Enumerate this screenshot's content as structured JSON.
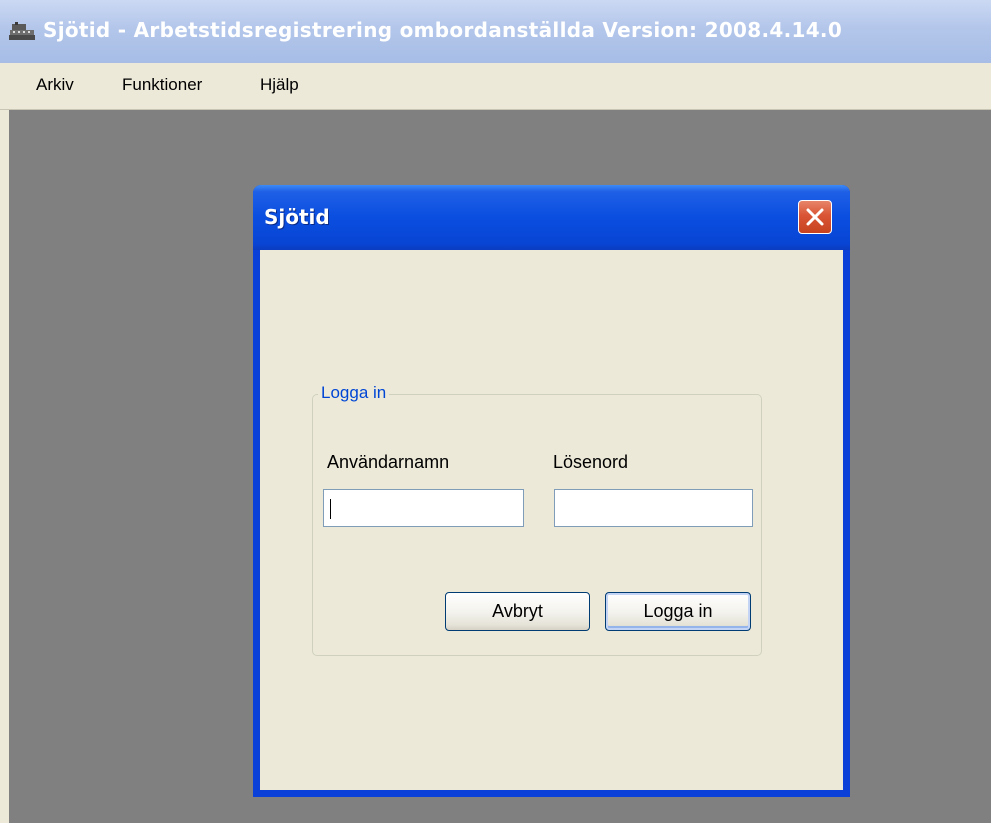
{
  "app": {
    "title": "Sjötid - Arbetstidsregistrering ombordanställda Version: 2008.4.14.0",
    "icon": "ship-icon"
  },
  "menu": {
    "items": [
      {
        "label": "Arkiv"
      },
      {
        "label": "Funktioner"
      },
      {
        "label": "Hjälp"
      }
    ]
  },
  "dialog": {
    "title": "Sjötid",
    "close_icon": "close-icon",
    "group": {
      "legend": "Logga in",
      "username_label": "Användarnamn",
      "username_value": "",
      "password_label": "Lösenord",
      "password_value": ""
    },
    "buttons": {
      "cancel_label": "Avbryt",
      "login_label": "Logga in"
    }
  },
  "colors": {
    "app_titlebar": "#b3c6ea",
    "dialog_titlebar": "#0a4ee0",
    "window_face": "#ece9d8",
    "mdi_background": "#808080",
    "legend_text": "#0046d5",
    "close_button": "#d95535"
  }
}
